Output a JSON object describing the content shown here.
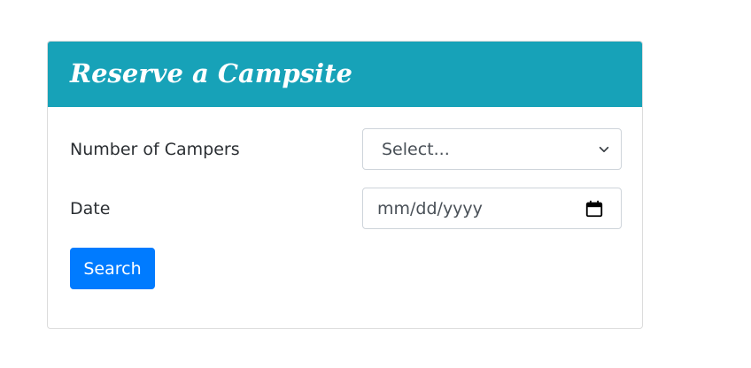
{
  "card": {
    "title": "Reserve a Campsite"
  },
  "form": {
    "campers": {
      "label": "Number of Campers",
      "selected": "Select..."
    },
    "date": {
      "label": "Date",
      "placeholder": "mm/dd/yyyy"
    },
    "search_label": "Search"
  },
  "icons": {
    "select_arrow": "chevron-down-icon",
    "date_picker": "calendar-icon"
  },
  "colors": {
    "header": "#17a2b8",
    "primary_button": "#007bff"
  }
}
